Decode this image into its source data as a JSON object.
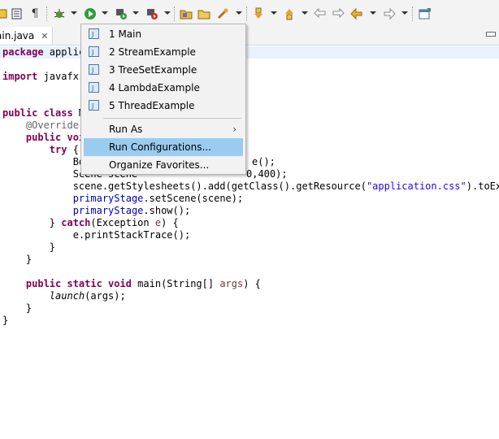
{
  "tab": {
    "label": "ain.java",
    "close": "✕"
  },
  "menu": {
    "recent": [
      "1 Main",
      "2 StreamExample",
      "3 TreeSetExample",
      "4 LambdaExample",
      "5 ThreadExample"
    ],
    "run_as": "Run As",
    "run_as_arrow": "›",
    "run_configurations": "Run Configurations...",
    "organize_favorites": "Organize Favorites..."
  },
  "code": {
    "l1_kw": "package",
    "l1_rest": " applic",
    "l3_kw": "import",
    "l3_rest": " javafx.",
    "l6_kw": "public class",
    "l6_rest": " M",
    "l7": "    @Override",
    "l8_kw": "    public voi",
    "l9_kw": "        try",
    "l9_rest": " {",
    "l10a": "            Bo",
    "l10b": "e();",
    "l11a": "            Scene scene",
    "l11b": "0,400);",
    "l12a": "            scene.getStylesheets().add(getClass().getResource(",
    "l12s": "\"application.css\"",
    "l12b": ").toExter",
    "l13a": "            ",
    "l13f": "primaryStage",
    "l13b": ".setScene(scene);",
    "l14a": "            ",
    "l14f": "primaryStage",
    "l14b": ".show();",
    "l15a": "        } ",
    "l15k": "catch",
    "l15b": "(Exception ",
    "l15p": "e",
    "l15c": ") {",
    "l16": "            e.printStackTrace();",
    "l17": "        }",
    "l18": "    }",
    "l20_kw": "    public static void",
    "l20_a": " main(String[] ",
    "l20_p": "args",
    "l20_b": ") {",
    "l21_a": "        ",
    "l21_i": "launch",
    "l21_b": "(args);",
    "l22": "    }",
    "l23": "}"
  },
  "colors": {
    "keyword": "#7f0055",
    "string": "#2a00ff",
    "field": "#0000c0",
    "annotation": "#646464",
    "menu_selection": "#99ccf0"
  }
}
